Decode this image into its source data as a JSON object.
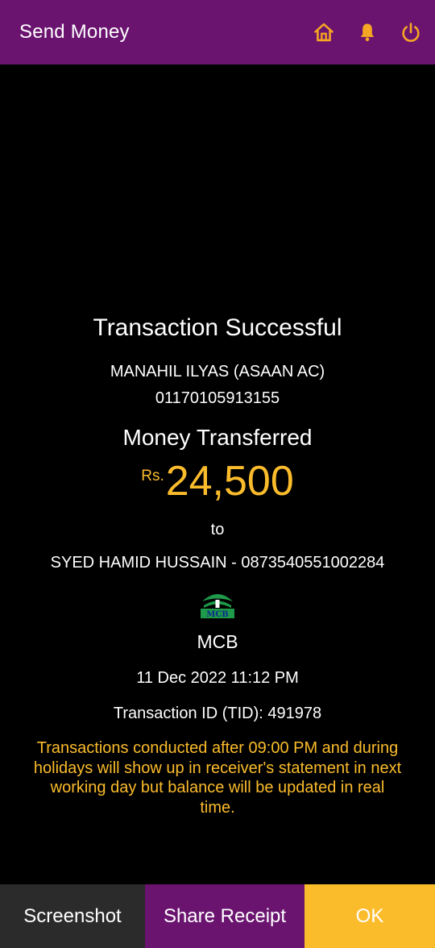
{
  "header": {
    "title": "Send Money",
    "icons": [
      "home-icon",
      "bell-icon",
      "power-icon"
    ],
    "icon_color": "#f5a623",
    "background": "#6a1470"
  },
  "transaction": {
    "status": "Transaction Successful",
    "sender_name": "MANAHIL ILYAS (ASAAN AC)",
    "sender_account": "01170105913155",
    "label": "Money Transferred",
    "currency": "Rs.",
    "amount": "24,500",
    "to_label": "to",
    "receiver": "SYED HAMID HUSSAIN - 0873540551002284",
    "bank_name": "MCB",
    "bank_logo_text": "MCB",
    "datetime": "11 Dec 2022 11:12 PM",
    "tid": "Transaction ID (TID): 491978",
    "notice": "Transactions conducted after 09:00 PM and during holidays will show up in receiver's statement in next working day but balance will be updated in real time."
  },
  "actions": {
    "screenshot": "Screenshot",
    "share": "Share Receipt",
    "ok": "OK"
  },
  "colors": {
    "accent": "#fbbc2c",
    "brand": "#6a1470",
    "background": "#000000"
  }
}
